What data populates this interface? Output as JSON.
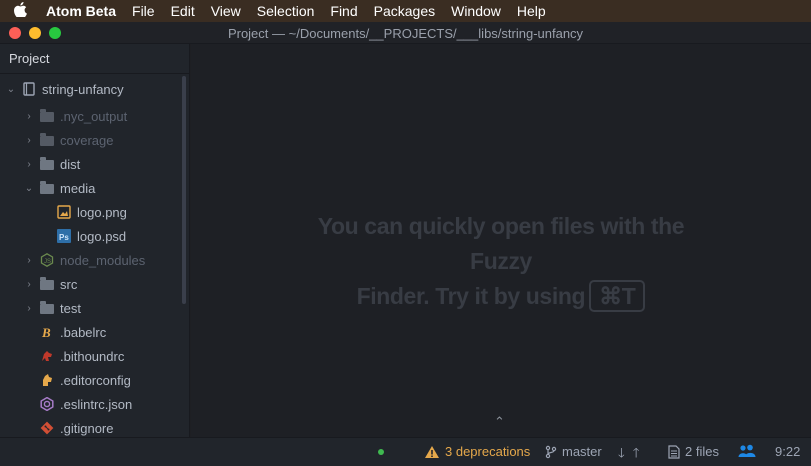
{
  "menubar": {
    "app_name": "Atom Beta",
    "items": [
      "File",
      "Edit",
      "View",
      "Selection",
      "Find",
      "Packages",
      "Window",
      "Help"
    ]
  },
  "window": {
    "title": "Project — ~/Documents/__PROJECTS/___libs/string-unfancy"
  },
  "tree": {
    "header": "Project",
    "root": "string-unfancy",
    "items": [
      {
        "label": ".nyc_output",
        "icon": "folder-icon",
        "state": "collapsed",
        "ignored": true
      },
      {
        "label": "coverage",
        "icon": "folder-icon",
        "state": "collapsed",
        "ignored": true
      },
      {
        "label": "dist",
        "icon": "folder-icon",
        "state": "collapsed",
        "ignored": false
      },
      {
        "label": "media",
        "icon": "folder-icon",
        "state": "expanded",
        "ignored": false
      },
      {
        "label": "logo.png",
        "icon": "image-file-icon",
        "ignored": false
      },
      {
        "label": "logo.psd",
        "icon": "photoshop-file-icon",
        "ignored": false
      },
      {
        "label": "node_modules",
        "icon": "nodejs-folder-icon",
        "state": "collapsed",
        "ignored": true
      },
      {
        "label": "src",
        "icon": "folder-icon",
        "state": "collapsed",
        "ignored": false
      },
      {
        "label": "test",
        "icon": "folder-icon",
        "state": "collapsed",
        "ignored": false
      },
      {
        "label": ".babelrc",
        "icon": "babel-icon",
        "ignored": false
      },
      {
        "label": ".bithoundrc",
        "icon": "bithound-icon",
        "ignored": false
      },
      {
        "label": ".editorconfig",
        "icon": "editorconfig-icon",
        "ignored": false
      },
      {
        "label": ".eslintrc.json",
        "icon": "eslint-icon",
        "ignored": false
      },
      {
        "label": ".gitignore",
        "icon": "git-icon",
        "ignored": false
      }
    ]
  },
  "editor": {
    "hint_line1": "You can quickly open files with the Fuzzy",
    "hint_line2": "Finder. Try it by using",
    "shortcut": "⌘T"
  },
  "status": {
    "deprecations": "3 deprecations",
    "branch": "master",
    "files": "2 files",
    "time": "9:22"
  },
  "colors": {
    "warning": "#e5a84b",
    "accent_blue": "#1e88e5",
    "clean_dot": "#3fb950"
  }
}
